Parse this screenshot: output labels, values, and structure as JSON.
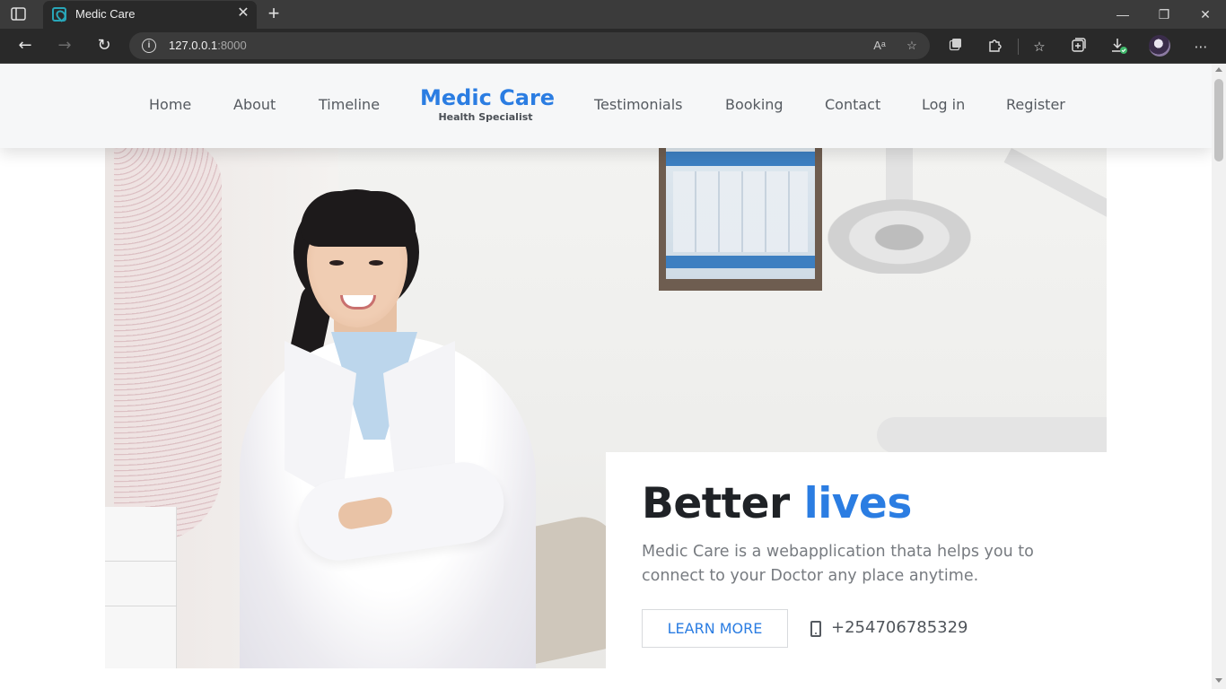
{
  "browser": {
    "tab_title": "Medic Care",
    "address_host": "127.0.0.1",
    "address_port": ":8000",
    "icons": {
      "tab_actions": "tab-actions-icon",
      "favicon": "site-favicon",
      "close": "close-icon",
      "new_tab": "plus-icon",
      "back": "back-arrow-icon",
      "forward": "forward-arrow-icon",
      "refresh": "refresh-icon",
      "site_info": "info-icon",
      "read_aloud": "read-aloud-icon",
      "favorite_add": "star-add-icon",
      "extensions": "puzzle-icon",
      "favorites": "favorites-icon",
      "collections": "collections-icon",
      "downloads": "download-icon",
      "menu": "more-icon"
    }
  },
  "nav": {
    "items_left": [
      "Home",
      "About",
      "Timeline"
    ],
    "brand_title": "Medic Care",
    "brand_subtitle": "Health Specialist",
    "items_right": [
      "Testimonials",
      "Booking",
      "Contact",
      "Log in",
      "Register"
    ]
  },
  "hero": {
    "headline_main": "Better",
    "headline_accent": "lives",
    "description": "Medic Care is a webapplication thata helps you to connect to your Doctor any place anytime.",
    "cta_label": "LEARN MORE",
    "phone": "+254706785329"
  },
  "colors": {
    "accent": "#2b7de2",
    "nav_background": "#f6f7f8",
    "heading": "#1f2226",
    "text_muted": "#777b80",
    "browser_frame": "#292929"
  }
}
